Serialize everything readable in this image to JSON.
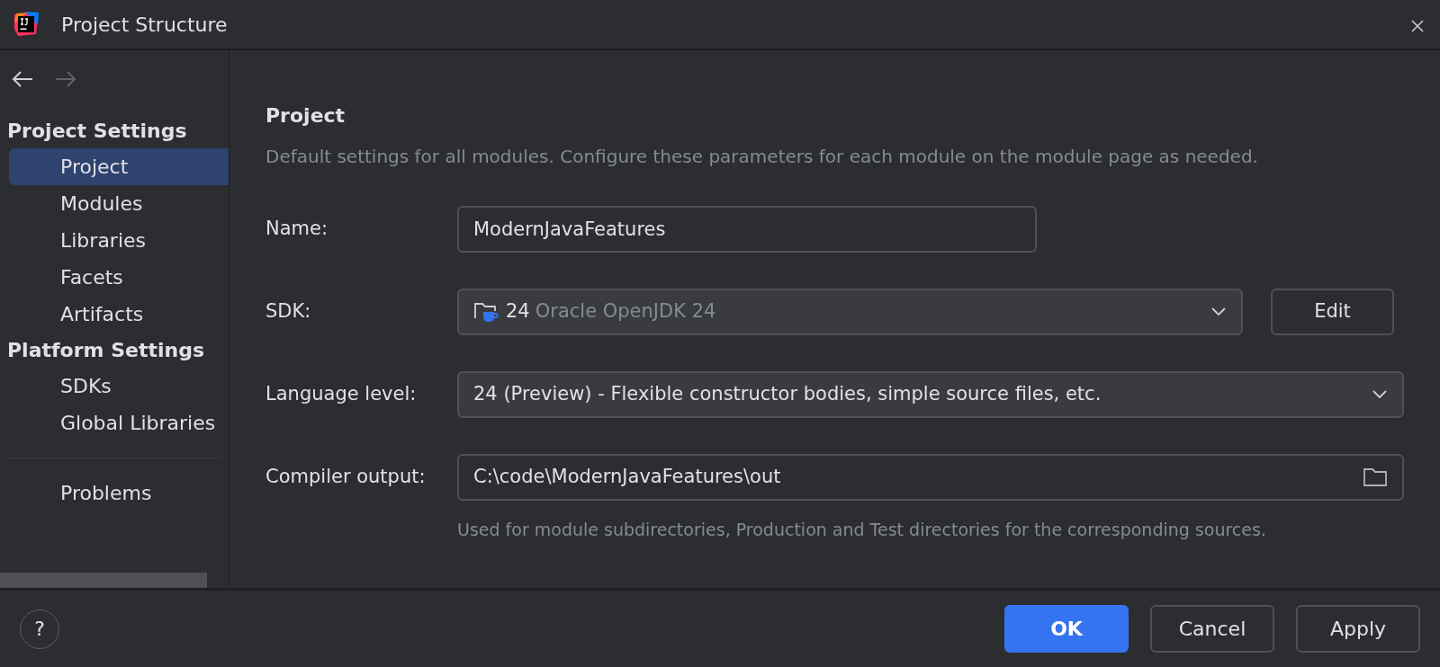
{
  "window": {
    "title": "Project Structure"
  },
  "navigation": {
    "back_enabled": true,
    "forward_enabled": false
  },
  "sidebar": {
    "groups": [
      {
        "title": "Project Settings",
        "items": [
          {
            "label": "Project",
            "selected": true
          },
          {
            "label": "Modules",
            "selected": false
          },
          {
            "label": "Libraries",
            "selected": false
          },
          {
            "label": "Facets",
            "selected": false
          },
          {
            "label": "Artifacts",
            "selected": false
          }
        ]
      },
      {
        "title": "Platform Settings",
        "items": [
          {
            "label": "SDKs",
            "selected": false
          },
          {
            "label": "Global Libraries",
            "selected": false
          }
        ]
      }
    ],
    "footer_items": [
      {
        "label": "Problems",
        "selected": false
      }
    ]
  },
  "page": {
    "title": "Project",
    "description": "Default settings for all modules. Configure these parameters for each module on the module page as needed.",
    "fields": [
      {
        "kind": "text",
        "label": "Name:",
        "value": "ModernJavaFeatures"
      },
      {
        "kind": "sdk",
        "label": "SDK:",
        "version": "24",
        "detail": "Oracle OpenJDK 24",
        "button": "Edit"
      },
      {
        "kind": "combo",
        "label": "Language level:",
        "value": "24 (Preview) - Flexible constructor bodies, simple source files, etc."
      },
      {
        "kind": "path",
        "label": "Compiler output:",
        "value": "C:\\code\\ModernJavaFeatures\\out",
        "hint": "Used for module subdirectories, Production and Test directories for the corresponding sources."
      }
    ]
  },
  "buttons": [
    {
      "label": "OK",
      "primary": true
    },
    {
      "label": "Cancel",
      "primary": false
    },
    {
      "label": "Apply",
      "primary": false
    }
  ],
  "help": {
    "label": "?"
  }
}
